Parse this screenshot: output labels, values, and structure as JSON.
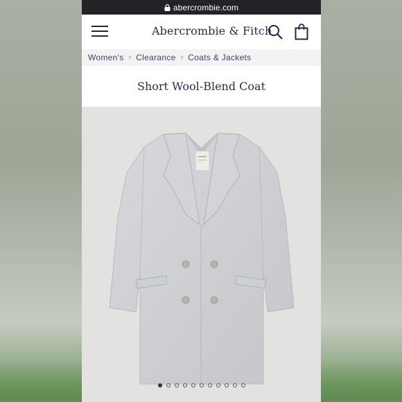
{
  "browser": {
    "url": "abercrombie.com"
  },
  "header": {
    "brand": "Abercrombie & Fitch"
  },
  "breadcrumb": {
    "items": [
      "Women's",
      "Clearance",
      "Coats & Jackets"
    ],
    "separator": "›"
  },
  "product": {
    "title": "Short Wool-Blend Coat"
  },
  "carousel": {
    "total": 11,
    "active_index": 0
  },
  "colors": {
    "url_bar": "#222326",
    "brand_navy": "#1f2d4a",
    "image_bg": "#e3e2e1",
    "coat_gray": "#cfd1d4"
  },
  "icons": [
    "lock-icon",
    "hamburger-menu-icon",
    "search-icon",
    "shopping-bag-icon"
  ]
}
